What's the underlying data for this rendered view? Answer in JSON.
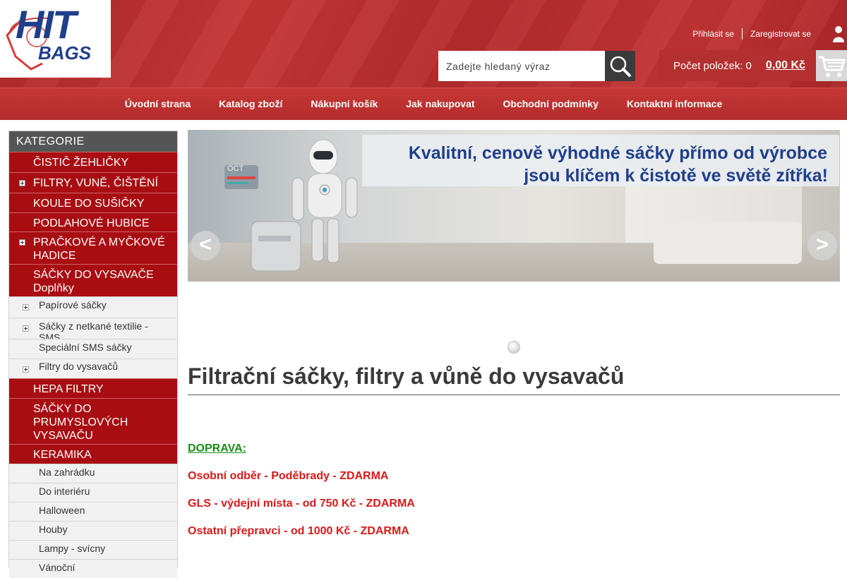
{
  "logo": {
    "hit": "HIT",
    "bags": "BAGS"
  },
  "header": {
    "login": "Přihlásit se",
    "register": "Zaregistrovat se",
    "search_placeholder": "Zadejte hledaný výraz",
    "cart_count": "Počet položek: 0",
    "cart_price": "0,00 Kč"
  },
  "nav": [
    "Úvodní strana",
    "Katalog zboží",
    "Nákupní košík",
    "Jak nakupovat",
    "Obchodní podmínky",
    "Kontaktní informace"
  ],
  "sidebar": {
    "title": "KATEGORIE",
    "cat1": "ČISTIČ ŽEHLIČKY",
    "cat2": "FILTRY, VUNĚ, ČIŠTĚNÍ",
    "cat3": "KOULE DO SUŠIČKY",
    "cat4": "PODLAHOVÉ HUBICE",
    "cat5": "PRAČKOVÉ A MYČKOVÉ HADICE",
    "cat6a": "SÁČKY DO VYSAVAČE",
    "cat6b": "Doplňky",
    "sub1": "Papírové sáčky",
    "sub2": "Sáčky z netkané textilie - SMS",
    "sub3": "Speciální SMS sáčky",
    "sub4": "Filtry do vysavačů",
    "cat7": "HEPA FILTRY",
    "cat8": "SÁČKY DO PRUMYSLOVÝCH VYSAVAČU",
    "cat9": "KERAMIKA",
    "sub5": "Na zahrádku",
    "sub6": "Do interiéru",
    "sub7": "Halloween",
    "sub8": "Houby",
    "sub9": "Lampy - svícny",
    "sub10": "Vánoční"
  },
  "banner": {
    "line1": "Kvalitní, cenově výhodné sáčky přímo od výrobce",
    "line2": "jsou klíčem k čistotě ve světě zítřka!",
    "oct": "OCT",
    "prev": "<",
    "next": ">"
  },
  "main": {
    "title": "Filtrační sáčky, filtry a vůně do vysavačů",
    "doprava": "DOPRAVA:",
    "info1": "Osobní odběr - Poděbrady - ZDARMA",
    "info2": "GLS - výdejní místa - od 750 Kč - ZDARMA",
    "info3": "Ostatní přepravci - od 1000 Kč - ZDARMA"
  }
}
